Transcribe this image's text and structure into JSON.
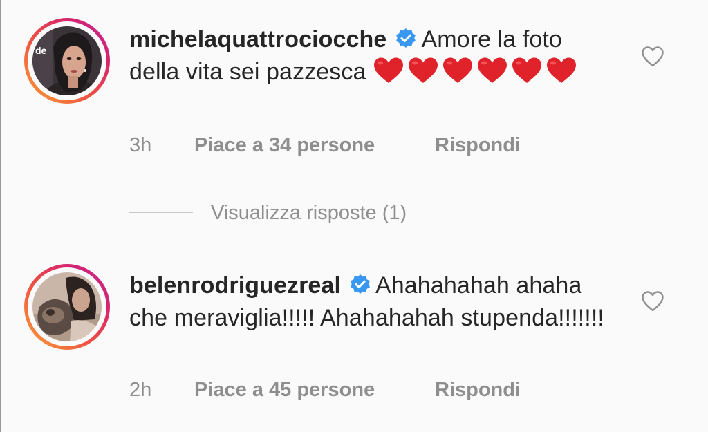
{
  "colors": {
    "background": "#fafafa",
    "text": "#262626",
    "secondary": "#8e8e8e",
    "verified": "#3897f0",
    "heart": "#e0232a",
    "story_ring": [
      "#f9a233",
      "#ee4d45",
      "#d6246e",
      "#bd2c9c"
    ]
  },
  "comments": [
    {
      "avatar_icon": "profile-photo",
      "username": "michelaquattrociocche",
      "verified": true,
      "text": "Amore la foto della vita sei pazzesca",
      "emoji": [
        "red-heart",
        "red-heart",
        "red-heart",
        "red-heart",
        "red-heart",
        "red-heart"
      ],
      "time": "3h",
      "likes_label": "Piace a 34 persone",
      "reply_label": "Rispondi",
      "like_icon": "heart-outline-icon"
    },
    {
      "avatar_icon": "profile-photo",
      "username": "belenrodriguezreal",
      "verified": true,
      "text": "Ahahahahah ahaha che meraviglia!!!!! Ahahahahah stupenda!!!!!!!",
      "time": "2h",
      "likes_label": "Piace a 45 persone",
      "reply_label": "Rispondi",
      "like_icon": "heart-outline-icon"
    }
  ],
  "view_replies": {
    "label": "Visualizza risposte (1)"
  }
}
